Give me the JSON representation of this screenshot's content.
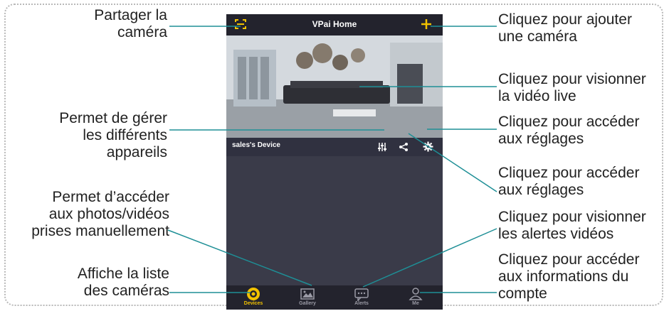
{
  "app": {
    "title": "VPai Home",
    "device_name": "sales's Device",
    "accent_color": "#f2c200",
    "tabs": [
      {
        "label": "Devices",
        "icon": "devices-icon",
        "active": true
      },
      {
        "label": "Gallery",
        "icon": "gallery-icon",
        "active": false
      },
      {
        "label": "Alerts",
        "icon": "alerts-icon",
        "active": false
      },
      {
        "label": "Me",
        "icon": "me-icon",
        "active": false
      }
    ]
  },
  "callouts": {
    "share_camera": "Partager la\ncaméra",
    "manage_devices": "Permet de gérer\nles différents\nappareils",
    "access_photos": "Permet d’accéder\naux photos/vidéos\nprises manuellement",
    "camera_list": "Affiche la liste\ndes caméras",
    "add_camera": "Cliquez pour ajouter\nune caméra",
    "watch_live": "Cliquez pour visionner\nla vidéo live",
    "settings_1": "Cliquez pour accéder\naux réglages",
    "settings_2": "Cliquez pour accéder\naux réglages",
    "view_alerts": "Cliquez pour visionner\nles alertes vidéos",
    "account_info": "Cliquez pour accéder\naux informations du\ncompte"
  },
  "line_color": "#1e8f96"
}
